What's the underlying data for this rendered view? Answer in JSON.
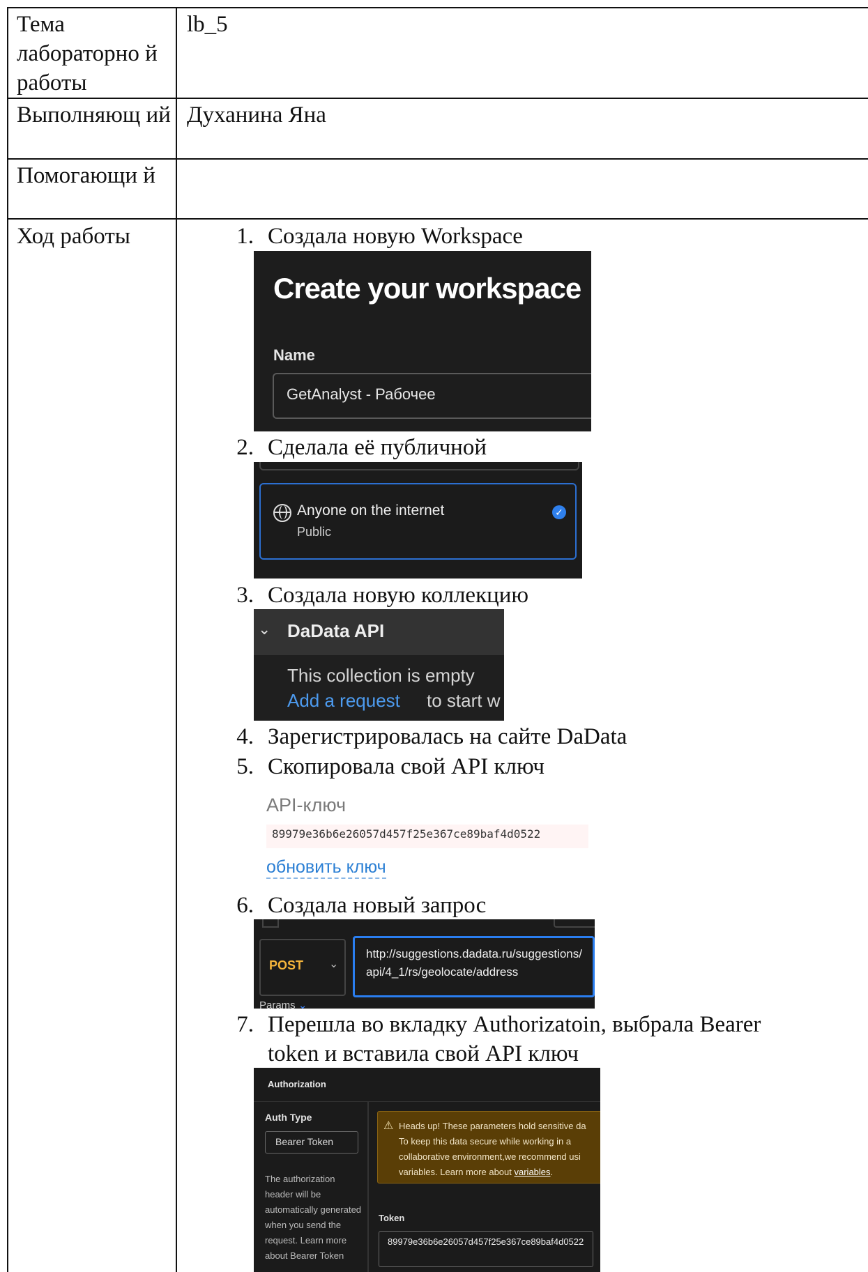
{
  "rows": [
    {
      "label": "Тема лабораторно й работы",
      "value": "lb_5"
    },
    {
      "label": "Выполняющ ий",
      "value": "Духанина Яна"
    },
    {
      "label": "Помогающи й",
      "value": ""
    },
    {
      "label": "Ход работы",
      "value": ""
    }
  ],
  "steps": [
    {
      "num": "1.",
      "text": "Создала новую Workspace"
    },
    {
      "num": "2.",
      "text": "Сделала её публичной"
    },
    {
      "num": "3.",
      "text": "Создала новую коллекцию"
    },
    {
      "num": "4.",
      "text": "Зарегистрировалась на сайте DaData"
    },
    {
      "num": "5.",
      "text": "Скопировала свой API ключ"
    },
    {
      "num": "6.",
      "text": "Создала новый запрос"
    },
    {
      "num": "7.",
      "text": "Перешла во вкладку Authorizatoin, выбрала Bearer token и вставила свой API ключ"
    }
  ],
  "shot_workspace": {
    "title": "Create your workspace",
    "name_label": "Name",
    "name_value": "GetAnalyst - Рабочее"
  },
  "shot_public": {
    "option": "Anyone on the internet",
    "sub": "Public",
    "icon": "globe-icon",
    "check_color": "#2f80ed"
  },
  "shot_collection": {
    "name": "DaData API",
    "empty": "This collection is empty",
    "link": "Add a request",
    "rest": "to start w"
  },
  "shot_apikey": {
    "heading": "API-ключ",
    "key": "89979e36b6e26057d457f25e367ce89baf4d0522",
    "refresh": "обновить ключ"
  },
  "shot_request": {
    "method": "POST",
    "url": "http://suggestions.dadata.ru/suggestions/api/4_1/rs/geolocate/address",
    "params": "Params"
  },
  "shot_auth": {
    "tab": "Authorization",
    "auth_type_label": "Auth Type",
    "auth_type_value": "Bearer Token",
    "description": "The authorization header will be automatically generated when you send the request. Learn more about Bearer Token",
    "warning_l1": "Heads up! These parameters hold sensitive da",
    "warning_l2": "To keep this data secure while working in a",
    "warning_l3": "collaborative environment,we recommend usi",
    "warning_l4": "variables. Learn more about",
    "warning_link": "variables",
    "token_label": "Token",
    "token_value": "89979e36b6e26057d457f25e367ce89baf4d0522"
  }
}
